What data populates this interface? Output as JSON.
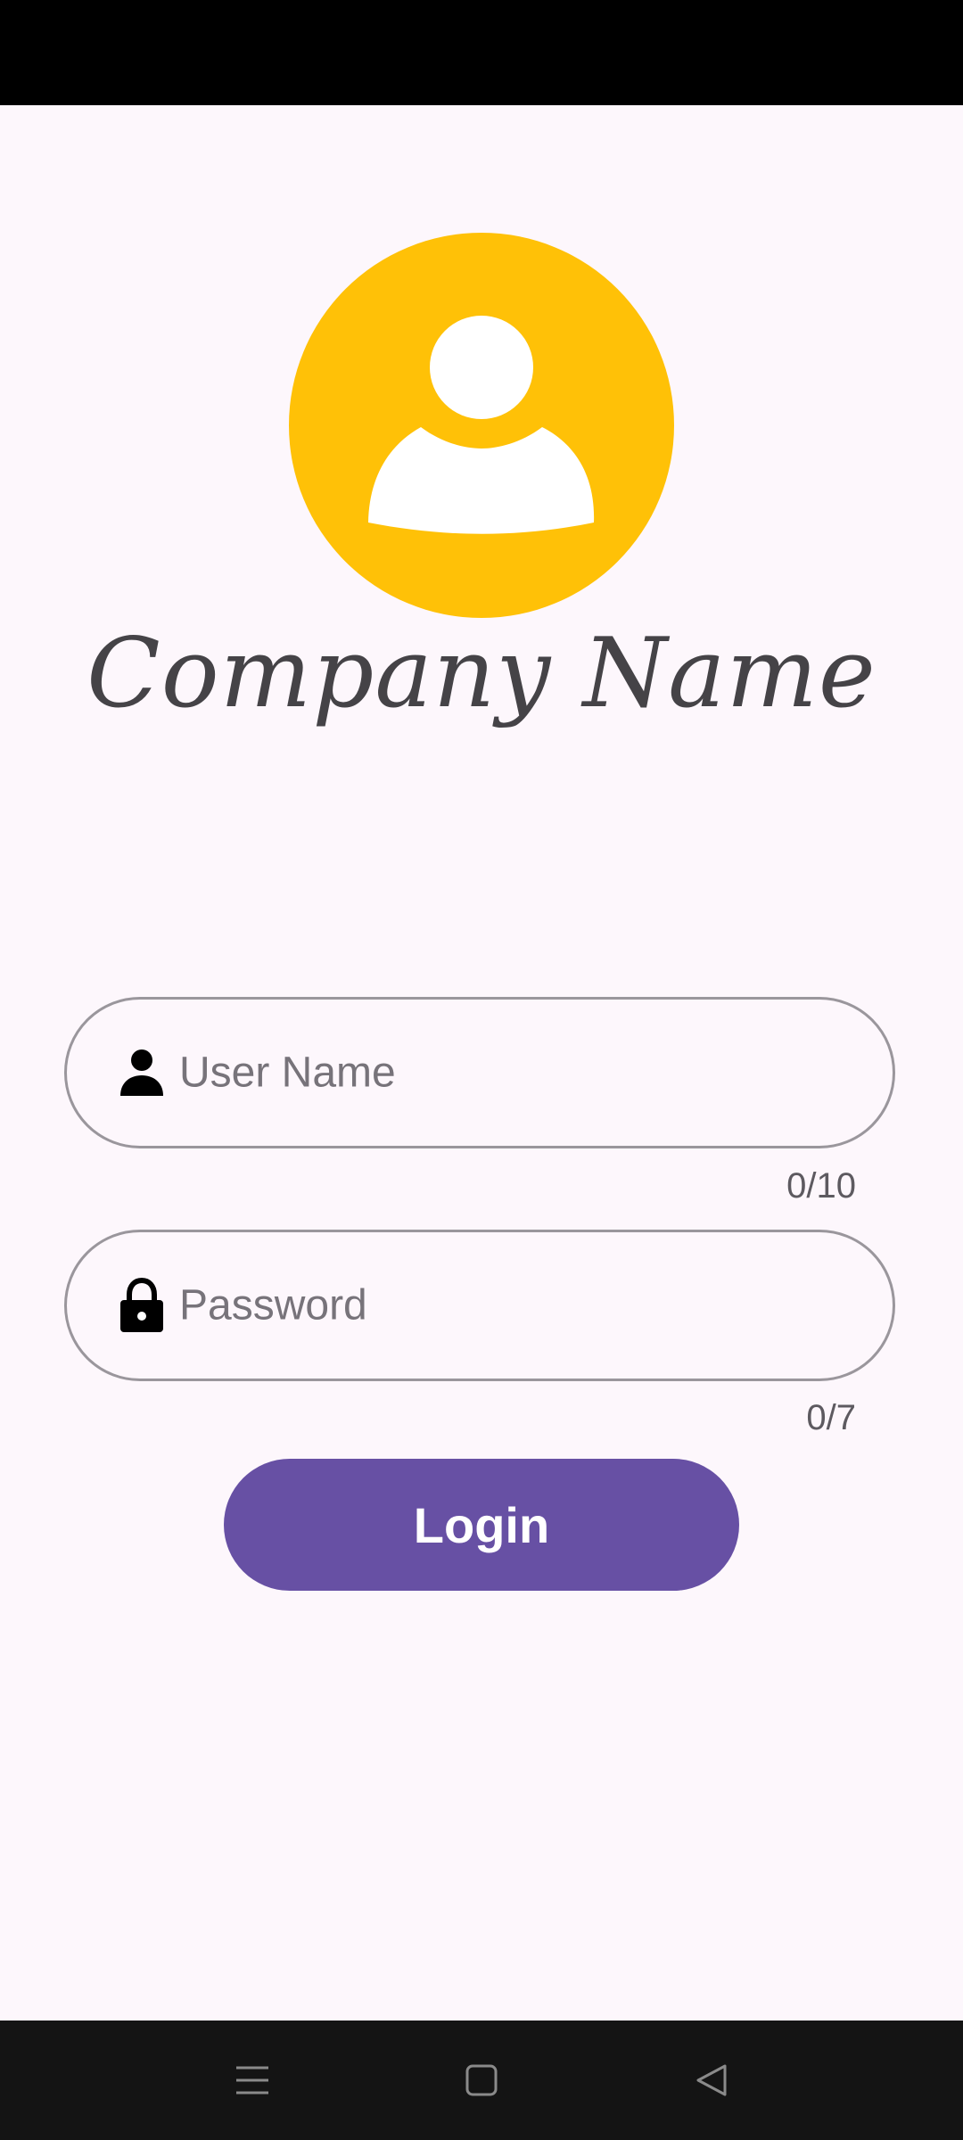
{
  "brand": {
    "company_name": "Company Name",
    "logo_icon": "user-avatar-icon",
    "logo_color": "#ffc107"
  },
  "form": {
    "username": {
      "icon": "person-icon",
      "placeholder": "User Name",
      "value": "",
      "counter": "0/10"
    },
    "password": {
      "icon": "lock-icon",
      "placeholder": "Password",
      "value": "",
      "counter": "0/7"
    },
    "login_label": "Login",
    "accent_color": "#6750a4"
  },
  "nav": {
    "items": [
      "menu-icon",
      "home-square-icon",
      "back-triangle-icon"
    ]
  }
}
